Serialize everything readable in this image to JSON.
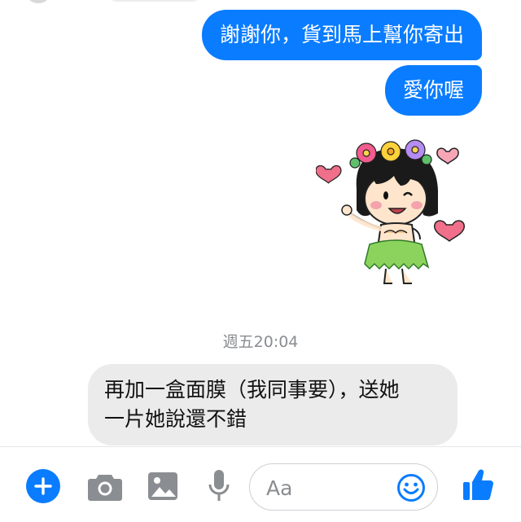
{
  "messages": {
    "outgoing": [
      "謝謝你，貨到馬上幫你寄出",
      "愛你喔"
    ],
    "timestamp": "週五20:04",
    "incoming": {
      "line1": "再加一盒面膜（我同事要），送她",
      "line2": "一片她說還不錯"
    }
  },
  "sticker": {
    "icon": "hula-girl-sticker"
  },
  "composer": {
    "placeholder": "Aa",
    "icons": [
      "plus-icon",
      "camera-icon",
      "image-icon",
      "microphone-icon",
      "emoji-icon",
      "thumbs-up-icon"
    ],
    "accent_color": "#0a7cff"
  }
}
